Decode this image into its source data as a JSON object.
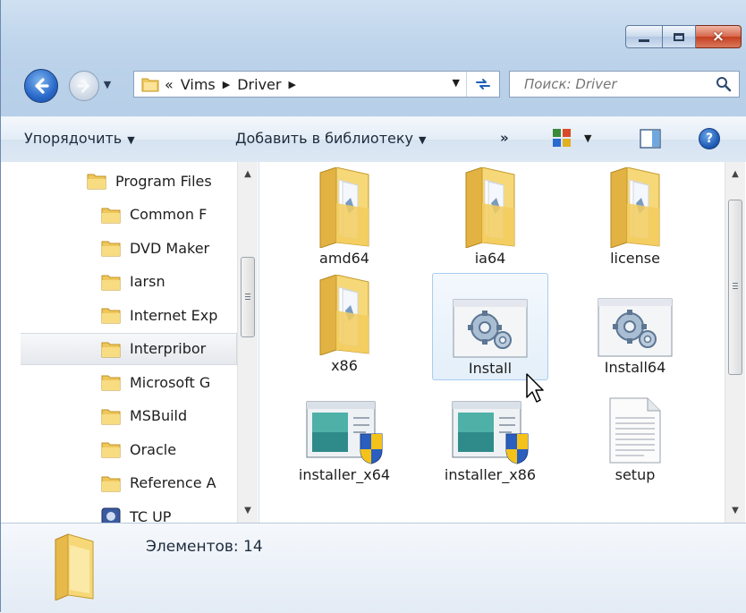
{
  "window": {
    "caption": {
      "minimize": "minimize",
      "maximize": "maximize",
      "close": "×"
    }
  },
  "address_bar": {
    "overflow": "«",
    "crumbs": [
      "Vims",
      "Driver"
    ]
  },
  "search": {
    "placeholder": "Поиск: Driver"
  },
  "toolbar": {
    "organize_label": "Упорядочить",
    "add_to_library_label": "Добавить в библиотеку",
    "more_label": "»"
  },
  "nav_tree": {
    "items": [
      {
        "label": "Program Files"
      },
      {
        "label": "Common F"
      },
      {
        "label": "DVD Maker"
      },
      {
        "label": "Iarsn"
      },
      {
        "label": "Internet Exp"
      },
      {
        "label": "Interpribor"
      },
      {
        "label": "Microsoft G"
      },
      {
        "label": "MSBuild"
      },
      {
        "label": "Oracle"
      },
      {
        "label": "Reference A"
      },
      {
        "label": "TC UP"
      }
    ],
    "selected_index": 5
  },
  "files": {
    "items": [
      {
        "name": "amd64",
        "type": "folder"
      },
      {
        "name": "ia64",
        "type": "folder"
      },
      {
        "name": "license",
        "type": "folder"
      },
      {
        "name": "x86",
        "type": "folder"
      },
      {
        "name": "Install",
        "type": "setup-app"
      },
      {
        "name": "Install64",
        "type": "setup-app"
      },
      {
        "name": "installer_x64",
        "type": "msi-installer"
      },
      {
        "name": "installer_x86",
        "type": "msi-installer"
      },
      {
        "name": "setup",
        "type": "text-file"
      }
    ],
    "selected_index": 4
  },
  "details": {
    "count_label": "Элементов: 14"
  },
  "colors": {
    "chrome": "#bcd3ea",
    "toolbar": "#dde8f4",
    "selection": "#e4eff9",
    "folder": "#f2cf6b"
  }
}
